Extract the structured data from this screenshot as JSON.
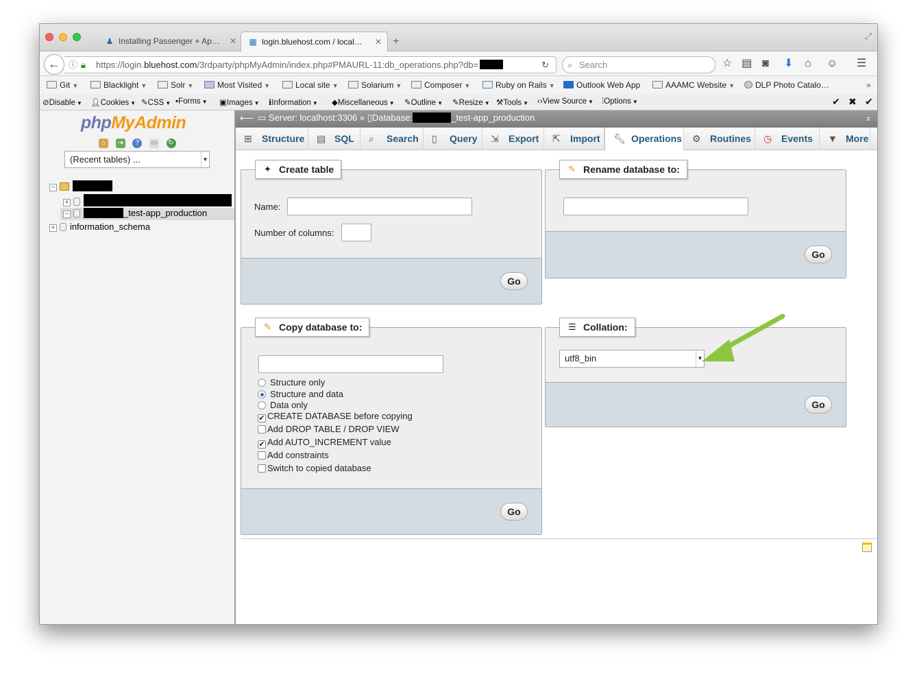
{
  "browser": {
    "tabs": [
      {
        "title": "Installing Passenger + Ap…",
        "active": false
      },
      {
        "title": "login.bluehost.com / local…",
        "active": true
      }
    ],
    "url_prefix": "https://login.",
    "url_domain": "bluehost.com",
    "url_suffix": "/3rdparty/phpMyAdmin/index.php#PMAURL-11:db_operations.php?db=",
    "search_placeholder": "Search"
  },
  "bookmarks": [
    "Git",
    "Blacklight",
    "Solr",
    "Most Visited",
    "Local site",
    "Solarium",
    "Composer",
    "Ruby on Rails",
    "Outlook Web App",
    "AAAMC Website",
    "DLP Photo Catalo…"
  ],
  "devbar": [
    "Disable",
    "Cookies",
    "CSS",
    "Forms",
    "Images",
    "Information",
    "Miscellaneous",
    "Outline",
    "Resize",
    "Tools",
    "View Source",
    "Options"
  ],
  "sidebar": {
    "logo_php": "php",
    "logo_my": "MyAdmin",
    "recent_select": "(Recent tables) ...",
    "db_test": "_test-app_production",
    "db_info": "information_schema"
  },
  "breadcrumb": {
    "server": "Server: localhost:3306",
    "sep": "»",
    "database_label": "Database:",
    "database_suffix": "_test-app_production"
  },
  "tabs": [
    "Structure",
    "SQL",
    "Search",
    "Query",
    "Export",
    "Import",
    "Operations",
    "Routines",
    "Events",
    "More"
  ],
  "active_tab": "Operations",
  "create_table": {
    "legend": "Create table",
    "name_label": "Name:",
    "columns_label": "Number of columns:",
    "go": "Go"
  },
  "rename_db": {
    "legend": "Rename database to:",
    "go": "Go"
  },
  "copy_db": {
    "legend": "Copy database to:",
    "radios": [
      {
        "label": "Structure only",
        "checked": false
      },
      {
        "label": "Structure and data",
        "checked": true
      },
      {
        "label": "Data only",
        "checked": false
      }
    ],
    "checks": [
      {
        "label": "CREATE DATABASE before copying",
        "checked": true
      },
      {
        "label": "Add DROP TABLE / DROP VIEW",
        "checked": false
      },
      {
        "label": "Add AUTO_INCREMENT value",
        "checked": true
      },
      {
        "label": "Add constraints",
        "checked": false
      },
      {
        "label": "Switch to copied database",
        "checked": false
      }
    ],
    "go": "Go"
  },
  "collation": {
    "legend": "Collation:",
    "selected": "utf8_bin",
    "go": "Go"
  },
  "colors": {
    "link": "#235a81",
    "panel_bg": "#eeeeee",
    "panel_footer": "#d4dce3",
    "annotation_arrow": "#8cc63f"
  }
}
